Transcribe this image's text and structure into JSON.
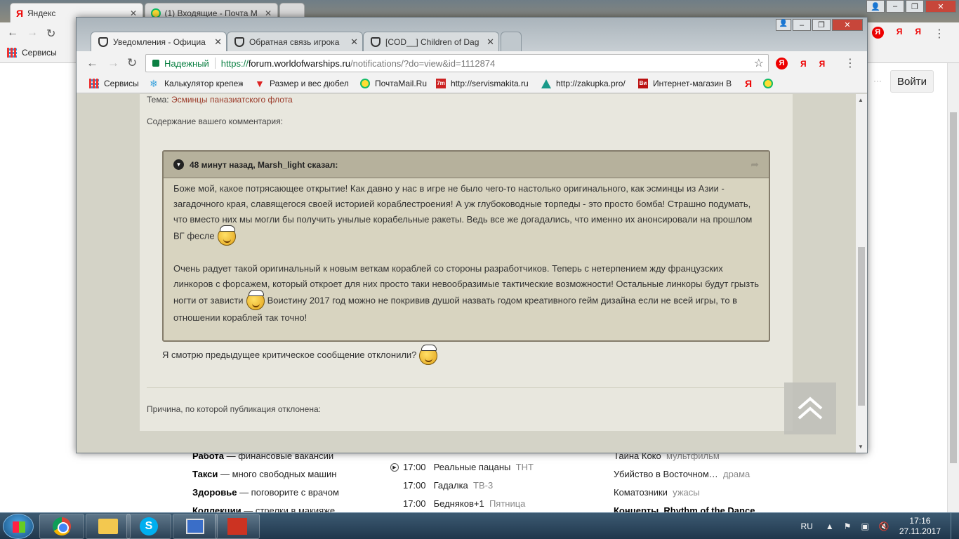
{
  "background_window": {
    "tabs": [
      {
        "label": "Яндекс"
      },
      {
        "label": "(1) Входящие - Почта М"
      }
    ],
    "bookmark_label": "Сервисы",
    "login_label": "Войти",
    "dots": "···",
    "left_list": [
      {
        "title": "Работа",
        "desc": "— финансовые вакансии"
      },
      {
        "title": "Такси",
        "desc": "— много свободных машин"
      },
      {
        "title": "Здоровье",
        "desc": "— поговорите с врачом"
      },
      {
        "title": "Коллекции",
        "desc": "— стрелки в макияже"
      }
    ],
    "tv_list": [
      {
        "time": "17:00",
        "title": "Реальные пацаны",
        "channel": "ТНТ"
      },
      {
        "time": "17:00",
        "title": "Гадалка",
        "channel": "ТВ-3"
      },
      {
        "time": "17:00",
        "title": "Бедняков+1",
        "channel": "Пятница"
      }
    ],
    "movies_list": [
      {
        "title": "Тайна Коко",
        "genre": "мультфильм"
      },
      {
        "title": "Убийство в Восточном…",
        "genre": "драма"
      },
      {
        "title": "Коматозники",
        "genre": "ужасы"
      },
      {
        "title": "Концерты",
        "genre": "Rhythm of the Dance"
      }
    ]
  },
  "window": {
    "tabs": [
      {
        "label": "Уведомления - Официа"
      },
      {
        "label": "Обратная связь игрока"
      },
      {
        "label": "[COD__] Children of Dag"
      }
    ],
    "close_glyph": "✕",
    "address": {
      "secure_label": "Надежный",
      "scheme": "https://",
      "host": "forum.worldofwarships.ru",
      "path": "/notifications/?do=view&id=1112874"
    },
    "ya_buttons": [
      "Я",
      "Я",
      "Я"
    ],
    "bookmarks": [
      {
        "label": "Сервисы",
        "icon": "apps-grid-icon"
      },
      {
        "label": "Калькулятор крепеж",
        "icon": "snowflake-icon"
      },
      {
        "label": "Размер и вес дюбел",
        "icon": "red-arrow-icon"
      },
      {
        "label": "ПочтаMail.Ru",
        "icon": "mail-ru-icon"
      },
      {
        "label": "http://servismakita.ru",
        "icon": "makita-icon"
      },
      {
        "label": "http://zakupka.pro/",
        "icon": "triangle-icon"
      },
      {
        "label": "Интернет-магазин В",
        "icon": "vi-icon"
      }
    ],
    "bookmark_badges": {
      "vi": "Ви",
      "mak": "7m",
      "ya": "Я"
    }
  },
  "page": {
    "topic_prefix": "Тема:",
    "topic_link": "Эсминцы паназиатского флота",
    "comment_label": "Содержание вашего комментария:",
    "quote": {
      "header": "48 минут назад, Marsh_light сказал:",
      "p1": "Боже мой, какое потрясающее открытие! Как давно у нас в игре не было чего-то настолько оригинального, как эсминцы из Азии - загадочного края, славящегося своей историей кораблестроения! А уж глубоководные торпеды - это просто бомба! Страшно подумать, что вместо них мы могли бы получить унылые корабельные ракеты. Ведь все же догадались, что именно их анонсировали на прошлом ВГ фесле",
      "p2a": "Очень радует такой оригинальный к новым веткам кораблей со стороны разработчиков. Теперь с нетерпением жду французских линкоров с форсажем, который откроет для них просто таки невообразимые тактические возможности! Остальные линкоры будут грызть ногти от зависти",
      "p2b": "Воистину 2017 год можно не покривив душой назвать годом креативного гейм дизайна если не всей игры, то в отношении кораблей так точно!"
    },
    "reply": "Я смотрю предыдущее критическое сообщение отклонили?",
    "reason_label": "Причина, по которой публикация отклонена:"
  },
  "taskbar": {
    "lang": "RU",
    "time": "17:16",
    "date": "27.11.2017"
  }
}
